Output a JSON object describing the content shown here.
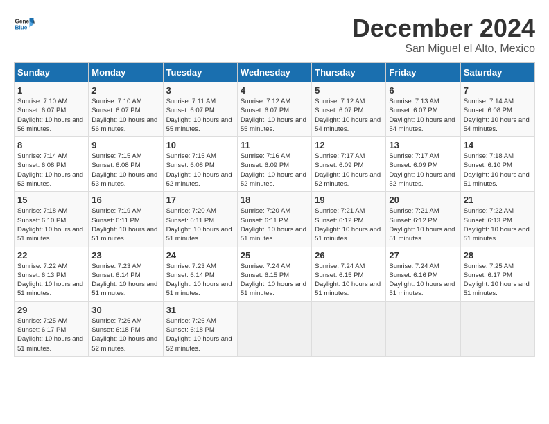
{
  "logo": {
    "general": "General",
    "blue": "Blue"
  },
  "title": {
    "month": "December 2024",
    "location": "San Miguel el Alto, Mexico"
  },
  "weekdays": [
    "Sunday",
    "Monday",
    "Tuesday",
    "Wednesday",
    "Thursday",
    "Friday",
    "Saturday"
  ],
  "weeks": [
    [
      {
        "day": "1",
        "sunrise": "7:10 AM",
        "sunset": "6:07 PM",
        "daylight": "10 hours and 56 minutes."
      },
      {
        "day": "2",
        "sunrise": "7:10 AM",
        "sunset": "6:07 PM",
        "daylight": "10 hours and 56 minutes."
      },
      {
        "day": "3",
        "sunrise": "7:11 AM",
        "sunset": "6:07 PM",
        "daylight": "10 hours and 55 minutes."
      },
      {
        "day": "4",
        "sunrise": "7:12 AM",
        "sunset": "6:07 PM",
        "daylight": "10 hours and 55 minutes."
      },
      {
        "day": "5",
        "sunrise": "7:12 AM",
        "sunset": "6:07 PM",
        "daylight": "10 hours and 54 minutes."
      },
      {
        "day": "6",
        "sunrise": "7:13 AM",
        "sunset": "6:07 PM",
        "daylight": "10 hours and 54 minutes."
      },
      {
        "day": "7",
        "sunrise": "7:14 AM",
        "sunset": "6:08 PM",
        "daylight": "10 hours and 54 minutes."
      }
    ],
    [
      {
        "day": "8",
        "sunrise": "7:14 AM",
        "sunset": "6:08 PM",
        "daylight": "10 hours and 53 minutes."
      },
      {
        "day": "9",
        "sunrise": "7:15 AM",
        "sunset": "6:08 PM",
        "daylight": "10 hours and 53 minutes."
      },
      {
        "day": "10",
        "sunrise": "7:15 AM",
        "sunset": "6:08 PM",
        "daylight": "10 hours and 52 minutes."
      },
      {
        "day": "11",
        "sunrise": "7:16 AM",
        "sunset": "6:09 PM",
        "daylight": "10 hours and 52 minutes."
      },
      {
        "day": "12",
        "sunrise": "7:17 AM",
        "sunset": "6:09 PM",
        "daylight": "10 hours and 52 minutes."
      },
      {
        "day": "13",
        "sunrise": "7:17 AM",
        "sunset": "6:09 PM",
        "daylight": "10 hours and 52 minutes."
      },
      {
        "day": "14",
        "sunrise": "7:18 AM",
        "sunset": "6:10 PM",
        "daylight": "10 hours and 51 minutes."
      }
    ],
    [
      {
        "day": "15",
        "sunrise": "7:18 AM",
        "sunset": "6:10 PM",
        "daylight": "10 hours and 51 minutes."
      },
      {
        "day": "16",
        "sunrise": "7:19 AM",
        "sunset": "6:11 PM",
        "daylight": "10 hours and 51 minutes."
      },
      {
        "day": "17",
        "sunrise": "7:20 AM",
        "sunset": "6:11 PM",
        "daylight": "10 hours and 51 minutes."
      },
      {
        "day": "18",
        "sunrise": "7:20 AM",
        "sunset": "6:11 PM",
        "daylight": "10 hours and 51 minutes."
      },
      {
        "day": "19",
        "sunrise": "7:21 AM",
        "sunset": "6:12 PM",
        "daylight": "10 hours and 51 minutes."
      },
      {
        "day": "20",
        "sunrise": "7:21 AM",
        "sunset": "6:12 PM",
        "daylight": "10 hours and 51 minutes."
      },
      {
        "day": "21",
        "sunrise": "7:22 AM",
        "sunset": "6:13 PM",
        "daylight": "10 hours and 51 minutes."
      }
    ],
    [
      {
        "day": "22",
        "sunrise": "7:22 AM",
        "sunset": "6:13 PM",
        "daylight": "10 hours and 51 minutes."
      },
      {
        "day": "23",
        "sunrise": "7:23 AM",
        "sunset": "6:14 PM",
        "daylight": "10 hours and 51 minutes."
      },
      {
        "day": "24",
        "sunrise": "7:23 AM",
        "sunset": "6:14 PM",
        "daylight": "10 hours and 51 minutes."
      },
      {
        "day": "25",
        "sunrise": "7:24 AM",
        "sunset": "6:15 PM",
        "daylight": "10 hours and 51 minutes."
      },
      {
        "day": "26",
        "sunrise": "7:24 AM",
        "sunset": "6:15 PM",
        "daylight": "10 hours and 51 minutes."
      },
      {
        "day": "27",
        "sunrise": "7:24 AM",
        "sunset": "6:16 PM",
        "daylight": "10 hours and 51 minutes."
      },
      {
        "day": "28",
        "sunrise": "7:25 AM",
        "sunset": "6:17 PM",
        "daylight": "10 hours and 51 minutes."
      }
    ],
    [
      {
        "day": "29",
        "sunrise": "7:25 AM",
        "sunset": "6:17 PM",
        "daylight": "10 hours and 51 minutes."
      },
      {
        "day": "30",
        "sunrise": "7:26 AM",
        "sunset": "6:18 PM",
        "daylight": "10 hours and 52 minutes."
      },
      {
        "day": "31",
        "sunrise": "7:26 AM",
        "sunset": "6:18 PM",
        "daylight": "10 hours and 52 minutes."
      },
      null,
      null,
      null,
      null
    ]
  ]
}
